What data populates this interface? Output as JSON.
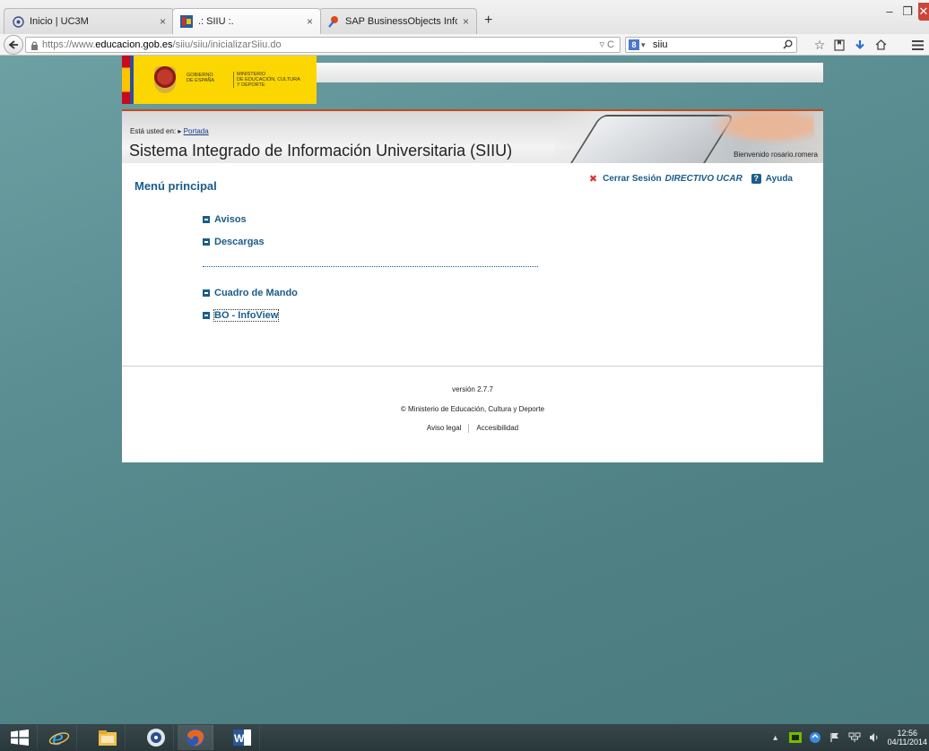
{
  "browser": {
    "tabs": [
      {
        "label": "Inicio | UC3M",
        "active": false
      },
      {
        "label": ".: SIIU :.",
        "active": true
      },
      {
        "label": "SAP BusinessObjects InfoVi...",
        "active": false
      }
    ],
    "tab_close": "×",
    "new_tab": "+",
    "window_controls": {
      "minimize": "–",
      "maximize": "❐",
      "close": "✕"
    },
    "url": {
      "scheme": "https://www.",
      "host": "educacion.gob.es",
      "path": "/siiu/siiu/inicializarSiiu.do"
    },
    "url_controls": "▿ C",
    "search": {
      "value": "siiu",
      "engine_icon": "8",
      "dropdown": "▾"
    },
    "icons": [
      "back-arrow-icon",
      "lock-icon",
      "reload-icon",
      "magnifier-icon",
      "star-icon",
      "bookmarks-icon",
      "download-icon",
      "home-icon",
      "menu-icon"
    ]
  },
  "gov": {
    "gobierno_line1": "GOBIERNO",
    "gobierno_line2": "DE ESPAÑA",
    "ministerio_line1": "MINISTERIO",
    "ministerio_line2": "DE EDUCACIÓN, CULTURA",
    "ministerio_line3": "Y DEPORTE"
  },
  "site": {
    "breadcrumb_prefix": "Está usted en:",
    "breadcrumb_link": "Portada",
    "title": "Sistema Integrado de Información Universitaria (SIIU)",
    "welcome": "Bienvenido rosario.romera"
  },
  "menu": {
    "title": "Menú principal",
    "logout_label": "Cerrar Sesión",
    "role": "DIRECTIVO UCAR",
    "help_label": "Ayuda",
    "help_icon_char": "?",
    "logout_icon_char": "✖",
    "items_top": [
      "Avisos",
      "Descargas"
    ],
    "items_bottom": [
      "Cuadro de Mando",
      "BO - InfoView"
    ]
  },
  "footer": {
    "version": "versión 2.7.7",
    "copyright": "© Ministerio de Educación, Cultura y Deporte",
    "link_legal": "Aviso legal",
    "link_access": "Accesibilidad"
  },
  "taskbar": {
    "apps": [
      "windows-start-icon",
      "internet-explorer-icon",
      "file-explorer-icon",
      "media-app-icon",
      "firefox-icon",
      "word-icon"
    ],
    "time": "12:56",
    "date": "04/11/2014"
  },
  "colors": {
    "link_blue": "#1a5c8a",
    "accent_orange": "#c44a1a",
    "gov_yellow": "#fcd600",
    "taskbar": "#2f3e42"
  }
}
